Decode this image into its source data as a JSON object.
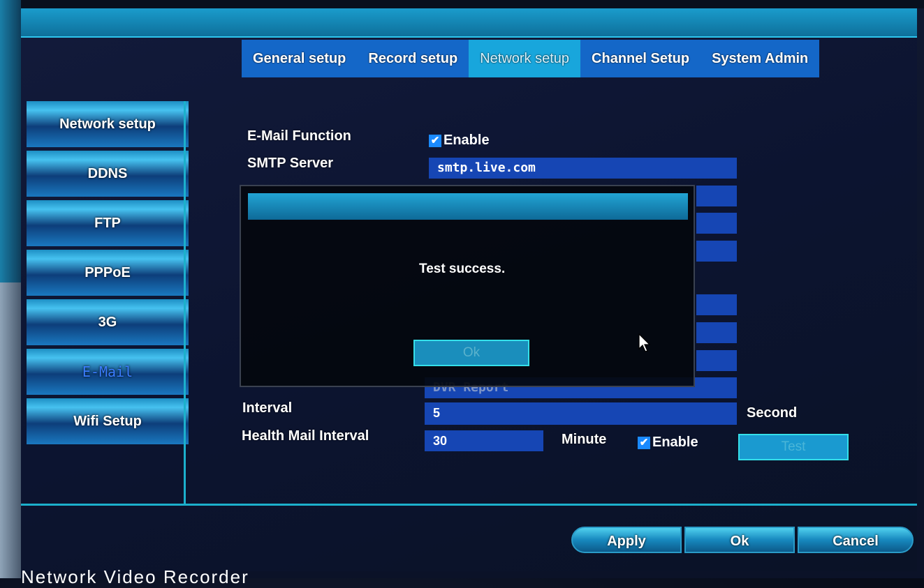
{
  "tabs": [
    {
      "label": "General setup"
    },
    {
      "label": "Record setup"
    },
    {
      "label": "Network setup"
    },
    {
      "label": "Channel Setup"
    },
    {
      "label": "System Admin"
    }
  ],
  "sidebar": {
    "items": [
      {
        "label": "Network setup"
      },
      {
        "label": "DDNS"
      },
      {
        "label": "FTP"
      },
      {
        "label": "PPPoE"
      },
      {
        "label": "3G"
      },
      {
        "label": "E-Mail"
      },
      {
        "label": "Wifi Setup"
      }
    ]
  },
  "form": {
    "email_function_label": "E-Mail Function",
    "email_enable_label": "Enable",
    "smtp_server_label": "SMTP Server",
    "smtp_server_value": "smtp.live.com",
    "subject_value": "DVR Report",
    "interval_label": "Interval",
    "interval_value": "5",
    "interval_unit": "Second",
    "health_label": "Health Mail Interval",
    "health_value": "30",
    "health_unit": "Minute",
    "health_enable_label": "Enable",
    "test_button": "Test"
  },
  "dialog": {
    "message": "Test success.",
    "ok_button": "Ok"
  },
  "buttons": {
    "apply": "Apply",
    "ok": "Ok",
    "cancel": "Cancel"
  },
  "footer": {
    "text": "Network Video Recorder"
  }
}
